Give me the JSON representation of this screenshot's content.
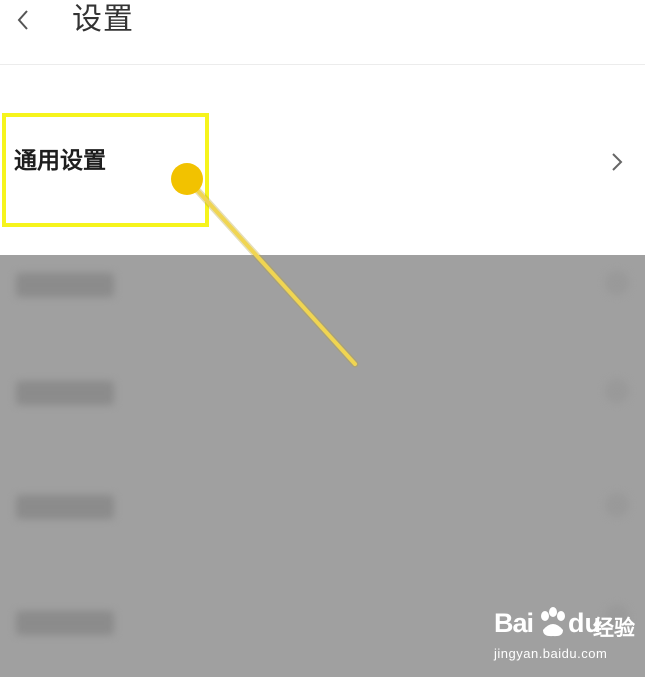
{
  "header": {
    "title": "设置",
    "back_icon": "chevron-left-icon"
  },
  "general_settings": {
    "label": "通用设置",
    "chevron_icon": "chevron-right-icon"
  },
  "annotation": {
    "highlight_color": "#f6f41c",
    "pointer_color": "#f2c500",
    "overlay_color": "#a0a0a0"
  },
  "watermark": {
    "brand": "Bai",
    "brand_suffix": "经验",
    "url": "jingyan.baidu.com",
    "logo_icon": "paw-icon"
  }
}
